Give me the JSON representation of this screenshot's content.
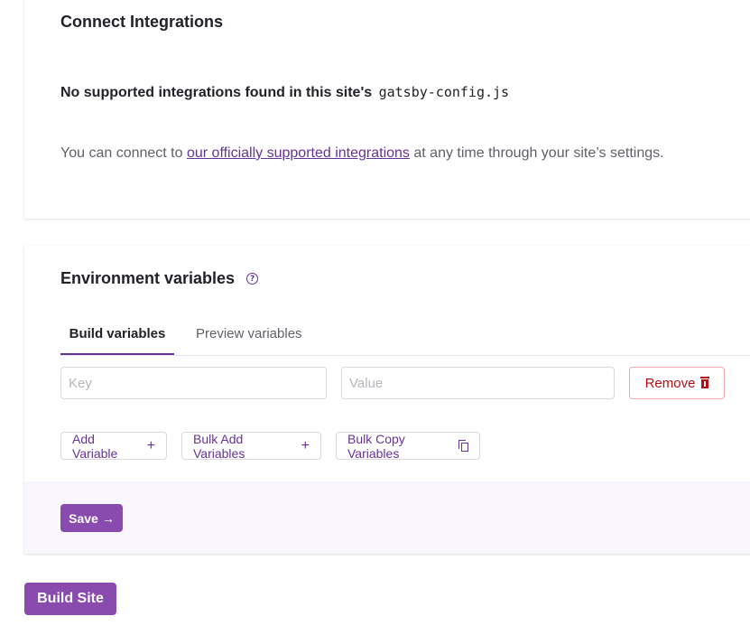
{
  "integrations": {
    "title": "Connect Integrations",
    "none_found_text": "No supported integrations found in this site's",
    "config_file": "gatsby-config.js",
    "connect_prefix": "You can connect to",
    "connect_link": "our officially supported integrations",
    "connect_suffix": "at any time through your site’s settings."
  },
  "env": {
    "title": "Environment variables",
    "help_icon": "question-circle-icon",
    "help_glyph": "?",
    "tabs": [
      {
        "label": "Build variables",
        "active": true
      },
      {
        "label": "Preview variables",
        "active": false
      }
    ],
    "key_placeholder": "Key",
    "key_value": "",
    "value_placeholder": "Value",
    "value_value": "",
    "remove_label": "Remove",
    "add_variable_label": "Add Variable",
    "bulk_add_label": "Bulk Add Variables",
    "bulk_copy_label": "Bulk Copy Variables",
    "plus_glyph": "+",
    "save_label": "Save",
    "save_arrow": "→"
  },
  "build_site_label": "Build Site",
  "colors": {
    "accent": "#663399",
    "button_purple": "#8a4baf",
    "danger": "#b80d16"
  }
}
